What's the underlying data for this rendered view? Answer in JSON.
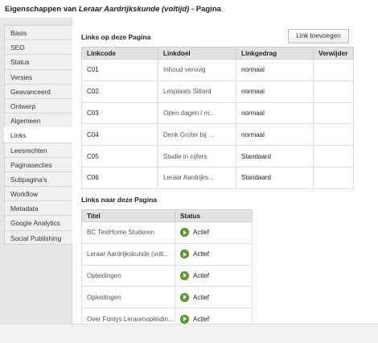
{
  "window": {
    "title_prefix": "Eigenschappen van ",
    "title_page_name": "Leraar Aardrijkskunde (voltijd)",
    "title_suffix": " - Pagina"
  },
  "sidebar": {
    "items": [
      {
        "label": "Basis",
        "active": false
      },
      {
        "label": "SEO",
        "active": false
      },
      {
        "label": "Status",
        "active": false
      },
      {
        "label": "Versies",
        "active": false
      },
      {
        "label": "Geavanceerd",
        "active": false
      },
      {
        "label": "Ontwerp",
        "active": false
      },
      {
        "label": "Algemeen",
        "active": false
      },
      {
        "label": "Links",
        "active": true
      },
      {
        "label": "Leesrechten",
        "active": false
      },
      {
        "label": "Paginasecties",
        "active": false
      },
      {
        "label": "Subpagina's",
        "active": false
      },
      {
        "label": "Workflow",
        "active": false
      },
      {
        "label": "Metadata",
        "active": false
      },
      {
        "label": "Google Analytics",
        "active": false
      },
      {
        "label": "Social Publishing",
        "active": false
      }
    ]
  },
  "links_section": {
    "title": "Links op deze Pagina",
    "add_button": "Link toevoegen",
    "columns": [
      "Linkcode",
      "Linkdoel",
      "Linkgedrag",
      "Verwijder"
    ],
    "rows": [
      {
        "code": "C01",
        "target": "Inhoud vervolg",
        "behavior": "normaal"
      },
      {
        "code": "C02",
        "target": "Lesplaats Sittard",
        "behavior": "normaal"
      },
      {
        "code": "C03",
        "target": "Open dagen / m...",
        "behavior": "normaal"
      },
      {
        "code": "C04",
        "target": "Denk Groter bij ...",
        "behavior": "normaal"
      },
      {
        "code": "C05",
        "target": "Studie in cijfers",
        "behavior": "Standaard"
      },
      {
        "code": "C06",
        "target": "Leraar Aardrijks...",
        "behavior": "Standaard"
      }
    ]
  },
  "backlinks_section": {
    "title": "Links naar deze Pagina",
    "columns": [
      "Titel",
      "Status"
    ],
    "rows": [
      {
        "title": "BC TestHome Studeren",
        "status": "Actief"
      },
      {
        "title": "Leraar Aardrijkskunde (volt...",
        "status": "Actief"
      },
      {
        "title": "Opleidingen",
        "status": "Actief"
      },
      {
        "title": "Opleidingen",
        "status": "Actief"
      },
      {
        "title": "Over Fontys Lerarenopleidin...",
        "status": "Actief"
      }
    ],
    "status_icon": "play-icon",
    "status_color": "#5aa32a"
  }
}
